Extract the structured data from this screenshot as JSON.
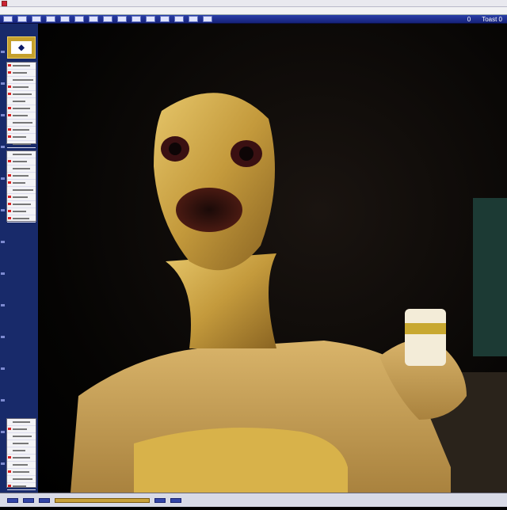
{
  "window": {
    "title": ""
  },
  "toolbar": {
    "zoom_label": "0",
    "search_label": "Toast 0"
  },
  "statusbar": {
    "text": ""
  },
  "colors": {
    "toolbar": "#1c2c8c",
    "panel": "#182a6a",
    "accent": "#c5a02c",
    "canvas": "#000000"
  },
  "icons": [
    "app-icon",
    "logo-icon"
  ]
}
